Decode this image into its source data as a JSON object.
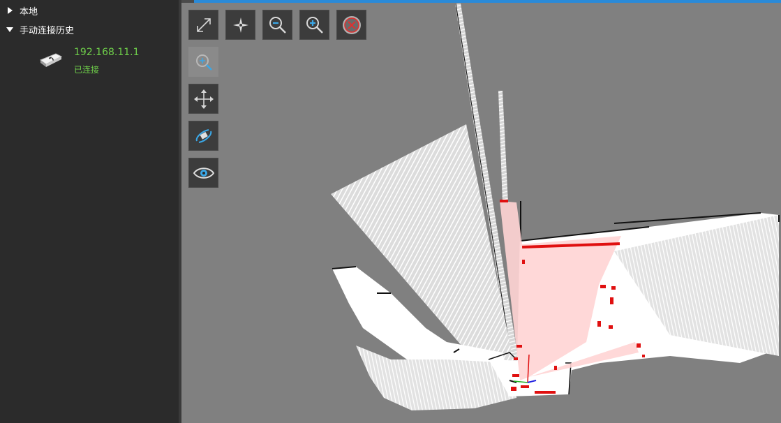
{
  "sidebar": {
    "tree": [
      {
        "label": "本地",
        "expanded": false
      },
      {
        "label": "手动连接历史",
        "expanded": true
      }
    ],
    "connection": {
      "ip": "192.168.11.1",
      "status": "已连接"
    }
  },
  "toolbar": {
    "tools": [
      {
        "name": "fit-view",
        "icon": "expand-arrows-icon",
        "enabled": true
      },
      {
        "name": "center-robot",
        "icon": "compass-star-icon",
        "enabled": true
      },
      {
        "name": "zoom-out",
        "icon": "zoom-out-icon",
        "enabled": true
      },
      {
        "name": "zoom-in",
        "icon": "zoom-in-icon",
        "enabled": true
      },
      {
        "name": "clear",
        "icon": "close-circle-icon",
        "enabled": true
      },
      {
        "name": "zoom-target",
        "icon": "zoom-target-icon",
        "enabled": false
      },
      {
        "name": "pan",
        "icon": "move-arrows-icon",
        "enabled": true
      },
      {
        "name": "set-pose",
        "icon": "robot-pose-icon",
        "enabled": true
      },
      {
        "name": "view-toggle",
        "icon": "eye-icon",
        "enabled": true
      }
    ]
  },
  "colors": {
    "accent": "#2a8ad8",
    "connected": "#6fcf4a",
    "map_unknown": "#808080",
    "map_free": "#ffffff",
    "laser": "#e01010",
    "laser_fill": "#ffd4d4"
  }
}
